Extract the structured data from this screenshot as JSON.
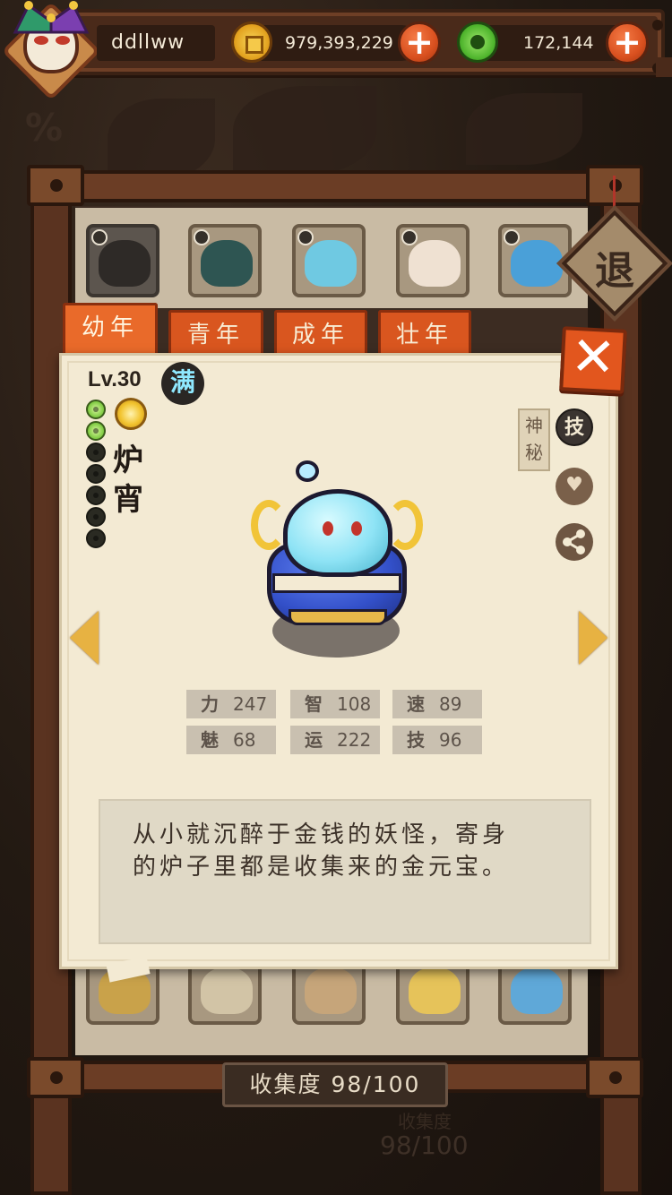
{
  "header": {
    "username": "ddllww",
    "gold": "979,393,229",
    "jade": "172,144",
    "plus_label": "+"
  },
  "background": {
    "percent_glyph": "%"
  },
  "retreat_label": "退",
  "tabs": [
    {
      "label": "幼年",
      "active": true
    },
    {
      "label": "青年",
      "active": false
    },
    {
      "label": "成年",
      "active": false
    },
    {
      "label": "壮年",
      "active": false
    }
  ],
  "detail": {
    "level": "Lv.30",
    "full_badge": "满",
    "name": "炉宵",
    "name_chars": [
      "炉",
      "宵"
    ],
    "pips_total": 7,
    "pips_on": 2,
    "side_tag": "神秘",
    "skill_label": "技",
    "close_label": "✕",
    "stats": [
      {
        "key": "力",
        "value": "247"
      },
      {
        "key": "智",
        "value": "108"
      },
      {
        "key": "速",
        "value": "89"
      },
      {
        "key": "魅",
        "value": "68"
      },
      {
        "key": "运",
        "value": "222"
      },
      {
        "key": "技",
        "value": "96"
      }
    ],
    "description_line1": "从小就沉醉于金钱的妖怪，寄身",
    "description_line2": "的炉子里都是收集来的金元宝。"
  },
  "collection": {
    "label": "收集度",
    "value": "98/100",
    "ghost_value": "98/100"
  },
  "colors": {
    "accent_orange": "#e2561e",
    "card_paper": "#f3ead3",
    "wood": "#6b3d25",
    "gold_arrow": "#e7b242"
  },
  "icons": {
    "gold": "gold-coin-icon",
    "jade": "jade-coin-icon",
    "plus": "plus-icon",
    "close": "close-icon",
    "prev": "arrow-left-icon",
    "next": "arrow-right-icon",
    "heart": "heart-icon",
    "share": "share-icon",
    "sun": "sun-icon"
  }
}
